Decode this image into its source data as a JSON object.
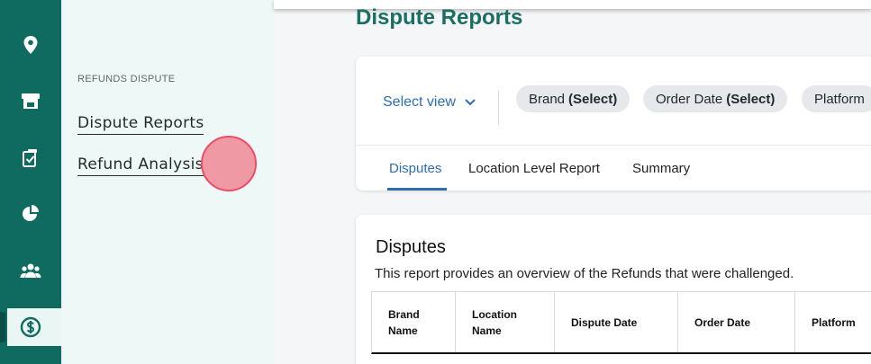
{
  "rail": {
    "icons": [
      "user-icon",
      "location-pin-icon",
      "store-icon",
      "clipboard-check-icon",
      "pie-chart-icon",
      "users-icon",
      "dollar-icon"
    ],
    "active": "dollar-icon",
    "brand_color": "#0f6b5f"
  },
  "subnav": {
    "section_label": "REFUNDS DISPUTE",
    "links": [
      "Dispute Reports",
      "Refund Analysis"
    ]
  },
  "main": {
    "page_title": "Dispute Reports",
    "filters": {
      "select_view": "Select view",
      "chips": [
        {
          "label": "Brand",
          "value": "(Select)"
        },
        {
          "label": "Order Date",
          "value": "(Select)"
        },
        {
          "label": "Platform",
          "value": ""
        }
      ]
    },
    "tabs": [
      "Disputes",
      "Location Level Report",
      "Summary"
    ],
    "active_tab": "Disputes",
    "report": {
      "title": "Disputes",
      "description": "This report provides an overview of the Refunds that were challenged.",
      "columns": [
        "Brand Name",
        "Location Name",
        "Dispute Date",
        "Order Date",
        "Platform"
      ]
    }
  },
  "colors": {
    "accent": "#2f6db5",
    "title_green": "#1b6e62",
    "click_marker": "#ec4c66"
  }
}
